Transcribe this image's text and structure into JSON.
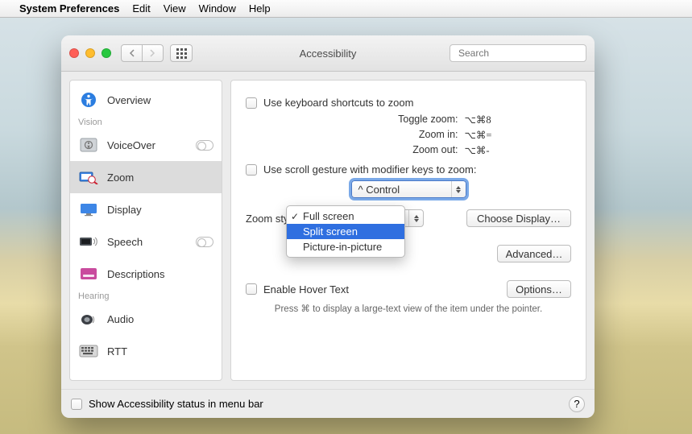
{
  "menubar": {
    "app": "System Preferences",
    "items": [
      "Edit",
      "View",
      "Window",
      "Help"
    ]
  },
  "window": {
    "title": "Accessibility",
    "search_placeholder": "Search"
  },
  "sidebar": {
    "cat_vision": "Vision",
    "cat_hearing": "Hearing",
    "items": [
      {
        "label": "Overview"
      },
      {
        "label": "VoiceOver"
      },
      {
        "label": "Zoom"
      },
      {
        "label": "Display"
      },
      {
        "label": "Speech"
      },
      {
        "label": "Descriptions"
      },
      {
        "label": "Audio"
      },
      {
        "label": "RTT"
      }
    ]
  },
  "panel": {
    "kb_shortcut_label": "Use keyboard shortcuts to zoom",
    "toggle_label": "Toggle zoom:",
    "toggle_keys": "⌥⌘8",
    "zoomin_label": "Zoom in:",
    "zoomin_keys": "⌥⌘=",
    "zoomout_label": "Zoom out:",
    "zoomout_keys": "⌥⌘-",
    "scroll_label": "Use scroll gesture with modifier keys to zoom:",
    "modifier_value": "^ Control",
    "zoom_style_label": "Zoom style:",
    "zoom_style_options": [
      "Full screen",
      "Split screen",
      "Picture-in-picture"
    ],
    "zoom_style_selected_index": 0,
    "zoom_style_highlighted_index": 1,
    "choose_display": "Choose Display…",
    "advanced": "Advanced…",
    "hover_label": "Enable Hover Text",
    "options": "Options…",
    "hover_hint": "Press ⌘ to display a large-text view of the item under the pointer."
  },
  "footer": {
    "statusbar_label": "Show Accessibility status in menu bar",
    "help": "?"
  }
}
